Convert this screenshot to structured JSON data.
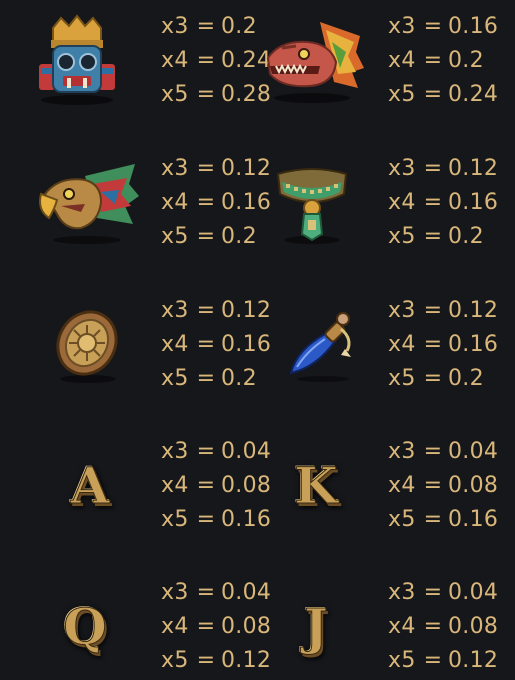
{
  "paytable": {
    "symbols": [
      {
        "icon": "tlaloc-mask-icon",
        "pays": [
          {
            "mult": "x3",
            "eq": "=",
            "val": "0.2"
          },
          {
            "mult": "x4",
            "eq": "=",
            "val": "0.24"
          },
          {
            "mult": "x5",
            "eq": "=",
            "val": "0.28"
          }
        ]
      },
      {
        "icon": "serpent-head-icon",
        "pays": [
          {
            "mult": "x3",
            "eq": "=",
            "val": "0.16"
          },
          {
            "mult": "x4",
            "eq": "=",
            "val": "0.2"
          },
          {
            "mult": "x5",
            "eq": "=",
            "val": "0.24"
          }
        ]
      },
      {
        "icon": "eagle-head-icon",
        "pays": [
          {
            "mult": "x3",
            "eq": "=",
            "val": "0.12"
          },
          {
            "mult": "x4",
            "eq": "=",
            "val": "0.16"
          },
          {
            "mult": "x5",
            "eq": "=",
            "val": "0.2"
          }
        ]
      },
      {
        "icon": "jade-necklace-icon",
        "pays": [
          {
            "mult": "x3",
            "eq": "=",
            "val": "0.12"
          },
          {
            "mult": "x4",
            "eq": "=",
            "val": "0.16"
          },
          {
            "mult": "x5",
            "eq": "=",
            "val": "0.2"
          }
        ]
      },
      {
        "icon": "golden-shield-icon",
        "pays": [
          {
            "mult": "x3",
            "eq": "=",
            "val": "0.12"
          },
          {
            "mult": "x4",
            "eq": "=",
            "val": "0.16"
          },
          {
            "mult": "x5",
            "eq": "=",
            "val": "0.2"
          }
        ]
      },
      {
        "icon": "obsidian-dagger-icon",
        "pays": [
          {
            "mult": "x3",
            "eq": "=",
            "val": "0.12"
          },
          {
            "mult": "x4",
            "eq": "=",
            "val": "0.16"
          },
          {
            "mult": "x5",
            "eq": "=",
            "val": "0.2"
          }
        ]
      },
      {
        "icon": "letter-a-icon",
        "letter": "A",
        "pays": [
          {
            "mult": "x3",
            "eq": "=",
            "val": "0.04"
          },
          {
            "mult": "x4",
            "eq": "=",
            "val": "0.08"
          },
          {
            "mult": "x5",
            "eq": "=",
            "val": "0.16"
          }
        ]
      },
      {
        "icon": "letter-k-icon",
        "letter": "K",
        "pays": [
          {
            "mult": "x3",
            "eq": "=",
            "val": "0.04"
          },
          {
            "mult": "x4",
            "eq": "=",
            "val": "0.08"
          },
          {
            "mult": "x5",
            "eq": "=",
            "val": "0.16"
          }
        ]
      },
      {
        "icon": "letter-q-icon",
        "letter": "Q",
        "pays": [
          {
            "mult": "x3",
            "eq": "=",
            "val": "0.04"
          },
          {
            "mult": "x4",
            "eq": "=",
            "val": "0.08"
          },
          {
            "mult": "x5",
            "eq": "=",
            "val": "0.12"
          }
        ]
      },
      {
        "icon": "letter-j-icon",
        "letter": "J",
        "pays": [
          {
            "mult": "x3",
            "eq": "=",
            "val": "0.04"
          },
          {
            "mult": "x4",
            "eq": "=",
            "val": "0.08"
          },
          {
            "mult": "x5",
            "eq": "=",
            "val": "0.12"
          }
        ]
      }
    ]
  },
  "colors": {
    "background": "#16171b",
    "payout_text": "#d9b77a",
    "letter_gold": "#c9a057"
  }
}
